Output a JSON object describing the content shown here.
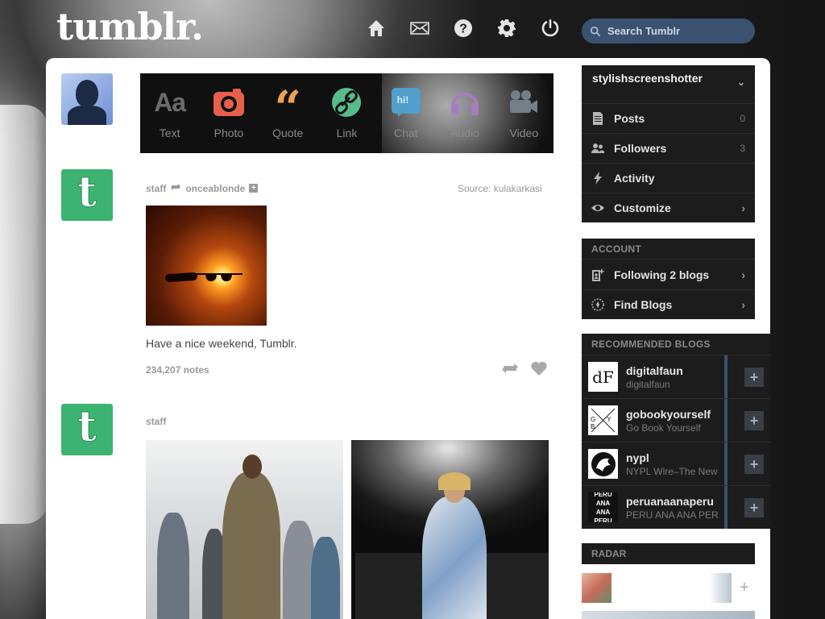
{
  "app": {
    "logo": "tumblr."
  },
  "nav": {
    "icons": [
      "home-icon",
      "inbox-icon",
      "help-icon",
      "settings-icon",
      "logout-icon"
    ]
  },
  "search": {
    "placeholder": "Search Tumblr"
  },
  "post_types": [
    {
      "label": "Text",
      "icon": "text-icon",
      "color": "#6b6b6b"
    },
    {
      "label": "Photo",
      "icon": "camera-icon",
      "color": "#e8604c"
    },
    {
      "label": "Quote",
      "icon": "quote-icon",
      "color": "#f0a24c"
    },
    {
      "label": "Link",
      "icon": "link-icon",
      "color": "#56bc8a"
    },
    {
      "label": "Chat",
      "icon": "chat-icon",
      "color": "#529ecc"
    },
    {
      "label": "Audio",
      "icon": "headphones-icon",
      "color": "#a77dc2"
    },
    {
      "label": "Video",
      "icon": "video-camera-icon",
      "color": "#748089"
    }
  ],
  "posts": [
    {
      "author": "staff",
      "reblogged_from": "onceablonde",
      "source_label": "Source:",
      "source": "kulakarkasi",
      "caption": "Have a nice weekend, Tumblr.",
      "notes": "234,207 notes"
    },
    {
      "author": "staff"
    }
  ],
  "sidebar": {
    "blog_name": "stylishscreenshotter",
    "blog_items": [
      {
        "label": "Posts",
        "count": "0",
        "icon": "document-icon"
      },
      {
        "label": "Followers",
        "count": "3",
        "icon": "people-icon"
      },
      {
        "label": "Activity",
        "count": "",
        "icon": "lightning-icon"
      },
      {
        "label": "Customize",
        "count": "",
        "icon": "eye-icon",
        "chevron": true
      }
    ],
    "account": {
      "title": "ACCOUNT",
      "items": [
        {
          "label": "Following 2 blogs",
          "icon": "add-person-icon"
        },
        {
          "label": "Find Blogs",
          "icon": "compass-icon"
        }
      ]
    },
    "recommended": {
      "title": "RECOMMENDED BLOGS",
      "items": [
        {
          "name": "digitalfaun",
          "title": "digitalfaun",
          "thumb_text": "dF"
        },
        {
          "name": "gobookyourself",
          "title": "Go Book Yourself",
          "thumb_text": "G Y B"
        },
        {
          "name": "nypl",
          "title": "NYPL Wire–The New",
          "thumb_text": ""
        },
        {
          "name": "peruanaanaperu",
          "title": "PERU ANA ANA PER",
          "thumb_text": "PERU ANA ANA PERU"
        }
      ]
    },
    "radar": {
      "title": "RADAR"
    }
  }
}
